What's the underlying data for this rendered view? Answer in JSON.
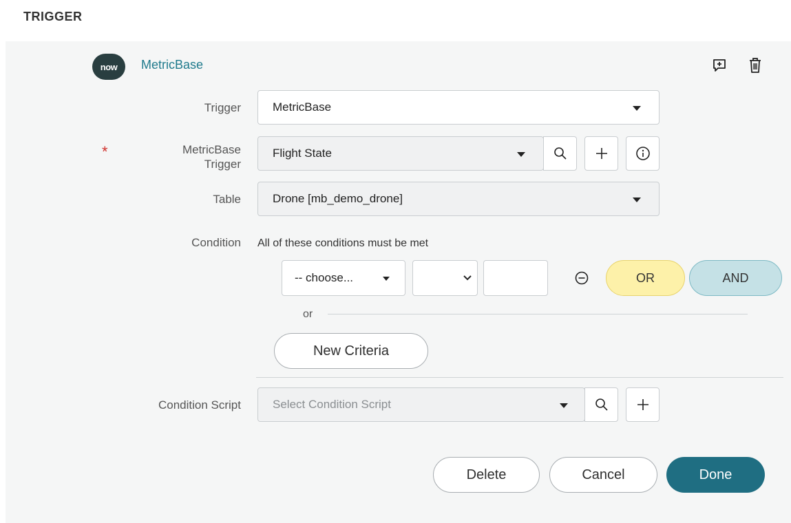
{
  "section": {
    "title": "TRIGGER"
  },
  "header": {
    "logo_text": "now",
    "trigger_name": "MetricBase",
    "icons": [
      "add-comment-icon",
      "trash-icon"
    ]
  },
  "form": {
    "trigger": {
      "label": "Trigger",
      "value": "MetricBase"
    },
    "metricbase_trigger": {
      "label_line1": "MetricBase",
      "label_line2": "Trigger",
      "required_mark": "*",
      "value": "Flight State"
    },
    "table": {
      "label": "Table",
      "value": "Drone [mb_demo_drone]"
    },
    "condition": {
      "label": "Condition",
      "description": "All of these conditions must be met",
      "field_select": "-- choose...",
      "operator_select": "",
      "value_input": "",
      "or_button": "OR",
      "and_button": "AND",
      "or_separator": "or",
      "new_criteria_button": "New Criteria"
    },
    "condition_script": {
      "label": "Condition Script",
      "placeholder": "Select Condition Script"
    }
  },
  "footer": {
    "delete": "Delete",
    "cancel": "Cancel",
    "done": "Done"
  },
  "colors": {
    "brand_teal": "#1f6e82",
    "or_yellow": "#fdf1a9",
    "and_blue": "#c5e1e6",
    "required_red": "#d0312d"
  }
}
